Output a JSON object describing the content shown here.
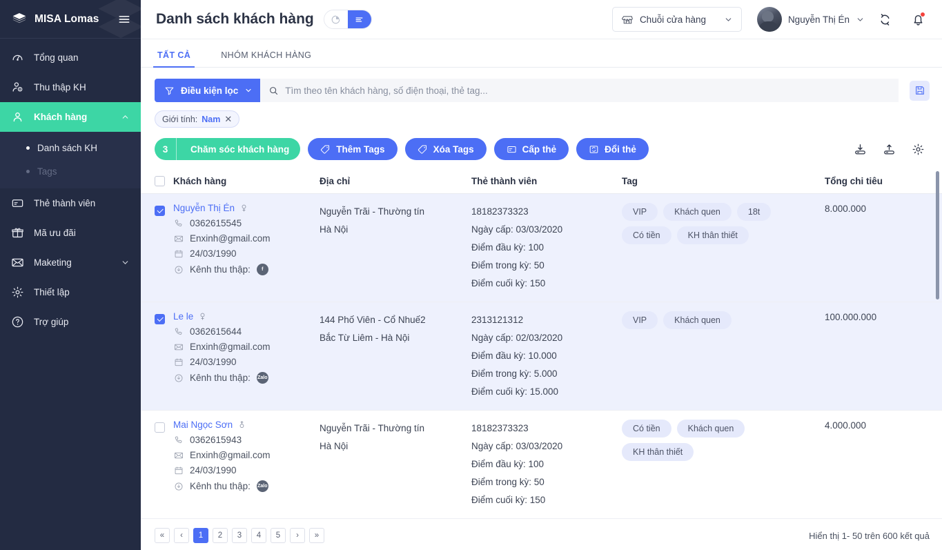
{
  "sidebar": {
    "brand": "MISA Lomas",
    "items": [
      {
        "label": "Tổng quan",
        "icon": "gauge-icon",
        "active": false
      },
      {
        "label": "Thu thập KH",
        "icon": "user-add-icon",
        "active": false
      },
      {
        "label": "Khách hàng",
        "icon": "user-icon",
        "active": true,
        "expanded": true
      },
      {
        "label": "Thẻ thành viên",
        "icon": "card-icon",
        "active": false
      },
      {
        "label": "Mã ưu đãi",
        "icon": "gift-icon",
        "active": false
      },
      {
        "label": "Maketing",
        "icon": "mail-icon",
        "active": false,
        "collapsed": true
      },
      {
        "label": "Thiết lập",
        "icon": "gear-icon",
        "active": false
      },
      {
        "label": "Trợ giúp",
        "icon": "help-icon",
        "active": false
      }
    ],
    "submenu": [
      {
        "label": "Danh sách KH",
        "active": true
      },
      {
        "label": "Tags",
        "active": false
      }
    ]
  },
  "header": {
    "title": "Danh sách khách hàng",
    "view_toggle": {
      "chart_label": "chart-view",
      "list_label": "list-view",
      "selected": "list"
    },
    "store_select": "Chuỗi cửa hàng",
    "user_name": "Nguyễn Thị Én"
  },
  "tabs": [
    {
      "label": "TẤT CẢ",
      "selected": true
    },
    {
      "label": "NHÓM KHÁCH HÀNG",
      "selected": false
    }
  ],
  "toolbar": {
    "filter_button": "Điều kiện lọc",
    "search_placeholder": "Tìm theo tên khách hàng, số điện thoại, thẻ tag...",
    "search_value": "",
    "save_icon": "floppy-save-icon",
    "chips": [
      {
        "label": "Giới tính:",
        "value": "Nam"
      }
    ],
    "actions": [
      {
        "label": "Chăm sóc khách hàng",
        "count": "3",
        "style": "green",
        "icon": ""
      },
      {
        "label": "Thêm Tags",
        "style": "blue",
        "icon": "tag-icon"
      },
      {
        "label": "Xóa Tags",
        "style": "blue",
        "icon": "tag-icon"
      },
      {
        "label": "Cấp thẻ",
        "style": "blue",
        "icon": "card-icon"
      },
      {
        "label": "Đổi thẻ",
        "style": "blue",
        "icon": "swap-card-icon"
      }
    ],
    "right_icons": [
      "download-icon",
      "upload-icon",
      "gear-icon"
    ]
  },
  "table": {
    "columns": [
      "Khách hàng",
      "Địa chỉ",
      "Thẻ thành viên",
      "Tag",
      "Tổng chi tiêu"
    ],
    "rows": [
      {
        "selected": true,
        "name": "Nguyễn Thị Én",
        "gender": "female",
        "phone": "0362615545",
        "email": "Enxinh@gmail.com",
        "birthday": "24/03/1990",
        "channel_label": "Kênh thu thập:",
        "channel": "facebook",
        "address": [
          "Nguyễn Trãi - Thường tín",
          "Hà Nội"
        ],
        "card_number": "18182373323",
        "card_lines": [
          "Ngày cấp: 03/03/2020",
          "Điểm đầu kỳ: 100",
          "Điểm trong kỳ: 50",
          "Điểm cuối kỳ: 150"
        ],
        "tags": [
          "VIP",
          "Khách quen",
          "18t",
          "Có tiền",
          "KH thân thiết"
        ],
        "total": "8.000.000"
      },
      {
        "selected": true,
        "name": "Le le",
        "gender": "female",
        "phone": "0362615644",
        "email": "Enxinh@gmail.com",
        "birthday": "24/03/1990",
        "channel_label": "Kênh thu thập:",
        "channel": "zalo",
        "address": [
          "144 Phố Viên - Cổ Nhuế2",
          "Bắc Từ Liêm - Hà Nội"
        ],
        "card_number": "2313121312",
        "card_lines": [
          "Ngày cấp: 02/03/2020",
          "Điểm đầu kỳ: 10.000",
          "Điểm trong kỳ: 5.000",
          "Điểm cuối kỳ: 15.000"
        ],
        "tags": [
          "VIP",
          "Khách quen"
        ],
        "total": "100.000.000"
      },
      {
        "selected": false,
        "name": "Mai Ngọc Sơn",
        "gender": "male",
        "phone": "0362615943",
        "email": "Enxinh@gmail.com",
        "birthday": "24/03/1990",
        "channel_label": "Kênh thu thập:",
        "channel": "zalo",
        "address": [
          "Nguyễn Trãi - Thường tín",
          "Hà Nội"
        ],
        "card_number": "18182373323",
        "card_lines": [
          "Ngày cấp: 03/03/2020",
          "Điểm đầu kỳ: 100",
          "Điểm trong kỳ: 50",
          "Điểm cuối kỳ: 150"
        ],
        "tags": [
          "Có tiền",
          "Khách quen",
          "KH thân thiết"
        ],
        "total": "4.000.000"
      }
    ]
  },
  "pagination": {
    "first": "«",
    "prev": "‹",
    "next": "›",
    "last": "»",
    "pages": [
      "1",
      "2",
      "3",
      "4",
      "5"
    ],
    "current": "1",
    "info": "Hiển thị 1- 50 trên 600 kết quả"
  },
  "colors": {
    "accent_blue": "#4c6ef5",
    "accent_green": "#3dd6a5",
    "sidebar_bg": "#232b42",
    "row_selected": "#eef1fd"
  }
}
